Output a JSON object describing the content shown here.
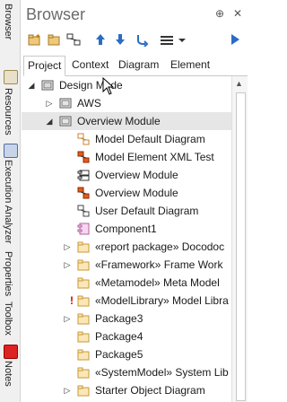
{
  "window": {
    "title": "Browser",
    "pin_glyph": "⊕",
    "close_glyph": "✕"
  },
  "dock_strip": [
    {
      "label": "Browser",
      "icon": "browser-icon"
    },
    {
      "label": "Resources",
      "icon": "resources-icon"
    },
    {
      "label": "Execution Analyzer",
      "icon": "execution-analyzer-icon"
    },
    {
      "label": "Properties",
      "icon": "properties-icon"
    },
    {
      "label": "Toolbox",
      "icon": "toolbox-icon"
    },
    {
      "label": "Notes",
      "icon": "notes-icon"
    }
  ],
  "toolbar": {
    "icons": [
      "new-package-icon",
      "new-folder-icon",
      "new-diagram-icon",
      "move-up-icon",
      "move-down-icon",
      "locate-icon",
      "menu-icon",
      "chevron-down-icon",
      "play-icon"
    ]
  },
  "tabs": [
    {
      "label": "Project",
      "active": true
    },
    {
      "label": "Context",
      "active": false
    },
    {
      "label": "Diagram",
      "active": false
    },
    {
      "label": "Element",
      "active": false
    }
  ],
  "tree": [
    {
      "label": "Design Mode",
      "icon": "model-root-icon",
      "expander": "open"
    },
    {
      "label": "AWS",
      "icon": "package-icon",
      "expander": "closed"
    },
    {
      "label": "Overview Module",
      "icon": "package-icon",
      "expander": "open",
      "selected": true
    },
    {
      "label": "Model Default Diagram",
      "icon": "diagram-icon"
    },
    {
      "label": "Model Element XML Test",
      "icon": "class-diagram-icon"
    },
    {
      "label": "Overview Module",
      "icon": "component-diagram-icon"
    },
    {
      "label": "Overview Module",
      "icon": "class-diagram-icon"
    },
    {
      "label": "User Default Diagram",
      "icon": "diagram-icon"
    },
    {
      "label": "Component1",
      "icon": "component-icon"
    },
    {
      "label": "«report package» Docodoc",
      "icon": "folder-icon",
      "expander": "closed"
    },
    {
      "label": "«Framework» Frame Work",
      "icon": "folder-icon",
      "expander": "closed"
    },
    {
      "label": "«Metamodel» Meta Model",
      "icon": "folder-icon"
    },
    {
      "label": "«ModelLibrary» Model Libra",
      "icon": "folder-icon",
      "warning": "!"
    },
    {
      "label": "Package3",
      "icon": "folder-icon",
      "expander": "closed"
    },
    {
      "label": "Package4",
      "icon": "folder-icon"
    },
    {
      "label": "Package5",
      "icon": "folder-icon"
    },
    {
      "label": "«SystemModel» System Lib",
      "icon": "folder-icon"
    },
    {
      "label": "Starter Object Diagram",
      "icon": "folder-icon",
      "expander": "closed"
    }
  ],
  "colors": {
    "title": "#6b6b6b",
    "selected_row": "#e6e6e6",
    "folder": "#f0c878",
    "diagram": "#c88432",
    "warning": "#d00000",
    "accent_blue": "#2b6cc4"
  }
}
